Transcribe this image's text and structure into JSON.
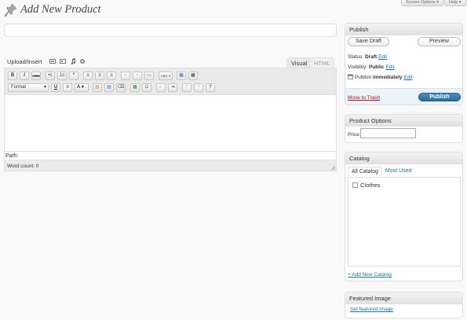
{
  "screen_options": {
    "screen_options_label": "Screen Options ▾",
    "help_label": "Help ▾"
  },
  "page": {
    "title": "Add New Product"
  },
  "editor": {
    "upload_label": "Upload/Insert",
    "tab_visual": "Visual",
    "tab_html": "HTML",
    "format_select": "Format",
    "path_label": "Path:",
    "word_count": "Word count: 0",
    "toolbar_row1": [
      "B",
      "I",
      "ABC",
      "•≡",
      "1≡",
      "“",
      "≡",
      "≡",
      "≡",
      "⚭",
      "⚭",
      "▭",
      "ABC",
      "▦",
      "▦"
    ],
    "toolbar_row2": [
      "U",
      "≡",
      "A",
      "▤",
      "▤",
      "⌫",
      "▦",
      "Ω",
      "⇤",
      "⇥",
      "↶",
      "↷",
      "?"
    ]
  },
  "publish": {
    "heading": "Publish",
    "save_draft": "Save Draft",
    "preview": "Preview",
    "status_label": "Status:",
    "status_value": "Draft",
    "status_edit": "Edit",
    "visibility_label": "Visibility:",
    "visibility_value": "Public",
    "visibility_edit": "Edit",
    "publish_label": "Publish",
    "publish_value": "immediately",
    "publish_edit": "Edit",
    "move_to_trash": "Move to Trash",
    "publish_button": "Publish"
  },
  "product_options": {
    "heading": "Product Options",
    "price_label": "Price",
    "price_value": ""
  },
  "catalog": {
    "heading": "Catalog",
    "tab_all": "All Catalog",
    "tab_most_used": "Most Used",
    "items": [
      {
        "label": "Clothes",
        "checked": false
      }
    ],
    "add_new": "+ Add New Catalog"
  },
  "featured_image": {
    "heading": "Featured Image",
    "set_link": "Set featured image"
  },
  "colors": {
    "accent": "#21759b",
    "publish_button": "#2e6f99",
    "trash": "#bc0b0b"
  }
}
